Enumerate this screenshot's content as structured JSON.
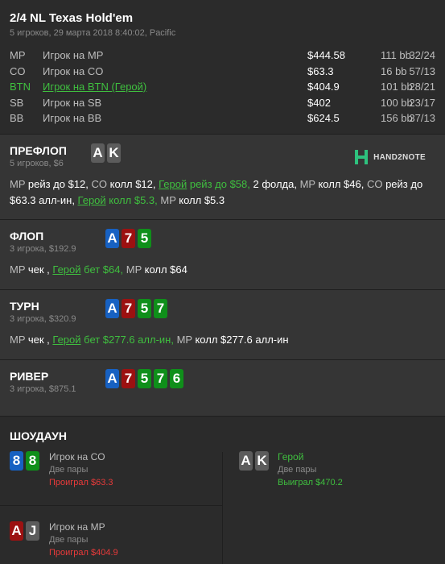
{
  "header": {
    "title": "2/4 NL Texas Hold'em",
    "subtitle": "5 игроков, 29 марта 2018 8:40:02, Pacific"
  },
  "players": [
    {
      "pos": "MP",
      "name": "Игрок на MP",
      "stack": "$444.58",
      "bb": "111 bb",
      "ratio": "32/24",
      "hero": false
    },
    {
      "pos": "CO",
      "name": "Игрок на CO",
      "stack": "$63.3",
      "bb": "16 bb",
      "ratio": "57/13",
      "hero": false
    },
    {
      "pos": "BTN",
      "name": "Игрок на BTN (Герой)",
      "stack": "$404.9",
      "bb": "101 bb",
      "ratio": "28/21",
      "hero": true
    },
    {
      "pos": "SB",
      "name": "Игрок на SB",
      "stack": "$402",
      "bb": "100 bb",
      "ratio": "23/17",
      "hero": false
    },
    {
      "pos": "BB",
      "name": "Игрок на BB",
      "stack": "$624.5",
      "bb": "156 bb",
      "ratio": "37/13",
      "hero": false
    }
  ],
  "logo": "HAND2NOTE",
  "preflop": {
    "name": "ПРЕФЛОП",
    "info": "5 игроков, $6",
    "cards": [
      {
        "rank": "A",
        "color": "gray"
      },
      {
        "rank": "K",
        "color": "gray"
      }
    ],
    "actions": [
      {
        "p": "MP",
        "a": " рейз до $12, "
      },
      {
        "p": "CO",
        "a": " колл $12, "
      },
      {
        "p": "Герой",
        "a": " рейз до $58, ",
        "hero": true
      },
      {
        "p": "",
        "a": "2 фолда, "
      },
      {
        "p": "MP",
        "a": " колл $46, "
      },
      {
        "p": "CO",
        "a": " рейз до $63.3 алл-ин, "
      },
      {
        "p": "Герой",
        "a": " колл $5.3, ",
        "hero": true
      },
      {
        "p": "MP",
        "a": " колл $5.3"
      }
    ]
  },
  "flop": {
    "name": "ФЛОП",
    "info": "3 игрока, $192.9",
    "cards": [
      {
        "rank": "A",
        "color": "blue"
      },
      {
        "rank": "7",
        "color": "red"
      },
      {
        "rank": "5",
        "color": "green"
      }
    ],
    "actions": [
      {
        "p": "MP",
        "a": " чек , "
      },
      {
        "p": "Герой",
        "a": " бет $64, ",
        "hero": true
      },
      {
        "p": "MP",
        "a": " колл $64"
      }
    ]
  },
  "turn": {
    "name": "ТУРН",
    "info": "3 игрока, $320.9",
    "cards": [
      {
        "rank": "A",
        "color": "blue"
      },
      {
        "rank": "7",
        "color": "red"
      },
      {
        "rank": "5",
        "color": "green"
      },
      {
        "rank": "7",
        "color": "green"
      }
    ],
    "actions": [
      {
        "p": "MP",
        "a": " чек , "
      },
      {
        "p": "Герой",
        "a": " бет $277.6 алл-ин, ",
        "hero": true
      },
      {
        "p": "MP",
        "a": " колл $277.6 алл-ин"
      }
    ]
  },
  "river": {
    "name": "РИВЕР",
    "info": "3 игрока, $875.1",
    "cards": [
      {
        "rank": "A",
        "color": "blue"
      },
      {
        "rank": "7",
        "color": "red"
      },
      {
        "rank": "5",
        "color": "green"
      },
      {
        "rank": "7",
        "color": "green"
      },
      {
        "rank": "6",
        "color": "green"
      }
    ]
  },
  "showdown": {
    "title": "ШОУДАУН",
    "entries": [
      {
        "name": "Игрок на CO",
        "hand": "Две пары",
        "result": "Проиграл $63.3",
        "won": false,
        "hero": false,
        "cards": [
          {
            "rank": "8",
            "color": "blue"
          },
          {
            "rank": "8",
            "color": "green"
          }
        ]
      },
      {
        "name": "Герой",
        "hand": "Две пары",
        "result": "Выиграл $470.2",
        "won": true,
        "hero": true,
        "cards": [
          {
            "rank": "A",
            "color": "gray"
          },
          {
            "rank": "K",
            "color": "gray"
          }
        ]
      },
      {
        "name": "Игрок на MP",
        "hand": "Две пары",
        "result": "Проиграл $404.9",
        "won": false,
        "hero": false,
        "cards": [
          {
            "rank": "A",
            "color": "red"
          },
          {
            "rank": "J",
            "color": "gray"
          }
        ]
      }
    ]
  }
}
